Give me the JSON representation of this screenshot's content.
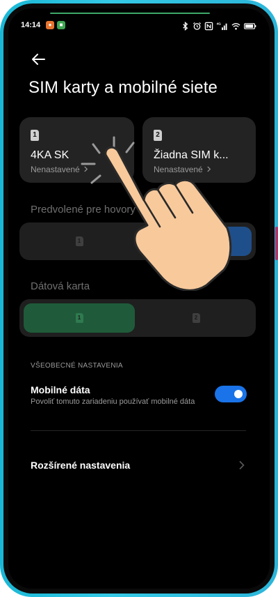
{
  "status_bar": {
    "time": "14:14",
    "network": "4G"
  },
  "header": {
    "title": "SIM karty a mobilné siete"
  },
  "sim_cards": [
    {
      "slot": "1",
      "name": "4KA SK",
      "status": "Nenastavené"
    },
    {
      "slot": "2",
      "name": "Žiadna SIM k...",
      "status": "Nenastavené"
    }
  ],
  "calls_default": {
    "label": "Predvolené pre hovory",
    "options": [
      "1",
      "2"
    ]
  },
  "data_card": {
    "label": "Dátová karta",
    "options": [
      "1",
      "2"
    ],
    "selected": "1"
  },
  "general": {
    "heading": "VŠEOBECNÉ NASTAVENIA",
    "mobile_data_title": "Mobilné dáta",
    "mobile_data_desc": "Povoliť tomuto zariadeniu používať mobilné dáta",
    "mobile_data_enabled": true,
    "advanced_label": "Rozšírené nastavenia"
  },
  "colors": {
    "accent": "#1a73e8",
    "data_selected": "#1f5b3a",
    "calls_selected": "#1f4f8a",
    "frame": "#2bb5d9"
  }
}
